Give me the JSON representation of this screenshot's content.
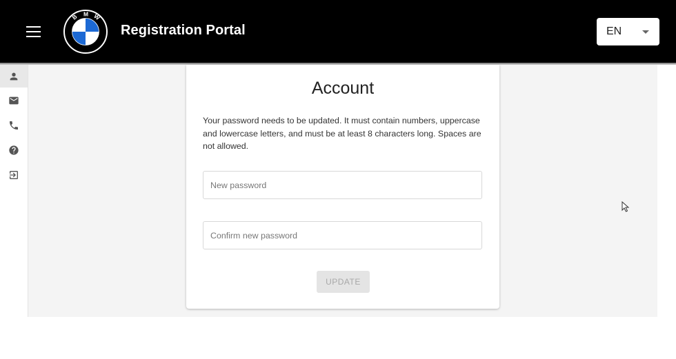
{
  "header": {
    "title": "Registration Portal",
    "logo_letters": "BMW",
    "language": {
      "selected": "EN"
    }
  },
  "sidebar": {
    "items": [
      {
        "icon": "person-icon",
        "active": true
      },
      {
        "icon": "mail-icon",
        "active": false
      },
      {
        "icon": "phone-icon",
        "active": false
      },
      {
        "icon": "help-icon",
        "active": false
      },
      {
        "icon": "logout-icon",
        "active": false
      }
    ]
  },
  "account": {
    "title": "Account",
    "message": "Your password needs to be updated. It must contain numbers, uppercase and lowercase letters, and must be at least 8 characters long. Spaces are not allowed.",
    "new_password": {
      "placeholder": "New password",
      "value": ""
    },
    "confirm_password": {
      "placeholder": "Confirm new password",
      "value": ""
    },
    "update_label": "UPDATE"
  },
  "colors": {
    "topbar": "#000000",
    "page_bg": "#f4f4f4",
    "logo_blue": "#1c69d4",
    "disabled_button": "#e4e4e4"
  }
}
